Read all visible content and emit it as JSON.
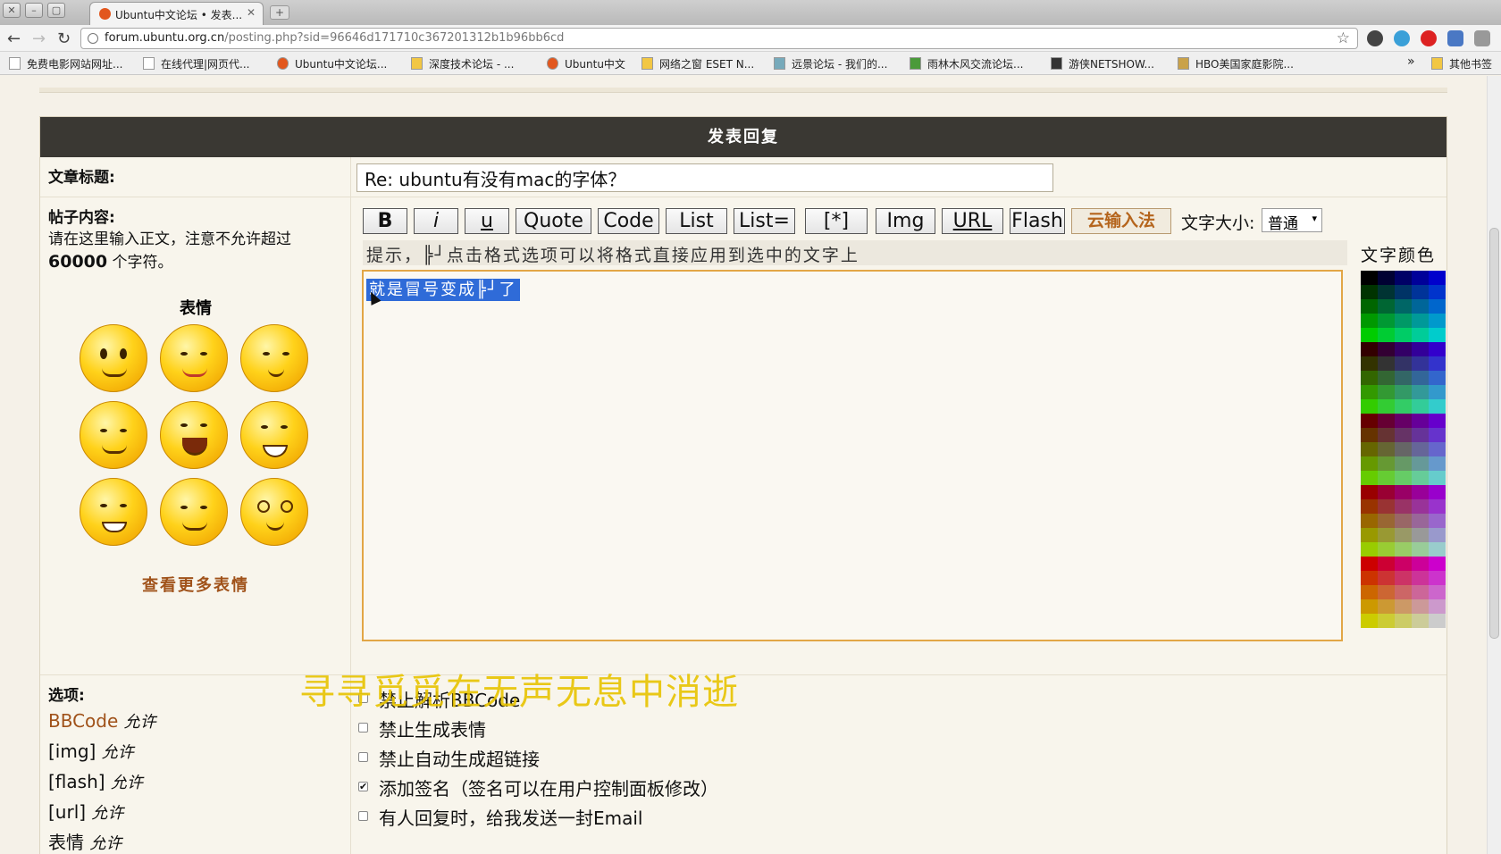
{
  "browser": {
    "tab_title": "Ubuntu中文论坛 • 发表...",
    "url_host": "forum.ubuntu.org.cn",
    "url_path": "/posting.php?sid=96646d171710c367201312b1b96bb6cd",
    "bookmarks": [
      "免费电影网站网址...",
      "在线代理|网页代...",
      "Ubuntu中文论坛...",
      "深度技术论坛 - ...",
      "Ubuntu中文",
      "网络之窗 ESET N...",
      "远景论坛 - 我们的...",
      "雨林木风交流论坛...",
      "游侠NETSHOW...",
      "HBO美国家庭影院..."
    ],
    "other_bookmarks": "其他书签",
    "more_bookmarks": "»"
  },
  "panel": {
    "title": "发表回复"
  },
  "subject": {
    "label": "文章标题:",
    "value": "Re: ubuntu有没有mac的字体？"
  },
  "content": {
    "label": "帖子内容:",
    "hint": "请在这里输入正文，注意不允许超过",
    "limit": "60000",
    "limit_suffix": "个字符。",
    "emote_title": "表情",
    "more_emotes": "查看更多表情",
    "buttons": [
      "B",
      "i",
      "u",
      "Quote",
      "Code",
      "List",
      "List=",
      "[*]",
      "Img",
      "URL",
      "Flash"
    ],
    "cloud_ime": "云输入法",
    "font_size_label": "文字大小:",
    "font_size_value": "普通",
    "tip": "提示，╠┘点击格式选项可以将格式直接应用到选中的文字上",
    "body_text": "就是冒号变成╠┘了",
    "color_label": "文字颜色"
  },
  "options": {
    "label": "选项:",
    "bbcode": "BBCode",
    "allowed": "允许",
    "img": "[img]",
    "flash": "[flash]",
    "url": "[url]",
    "smilies": "表情",
    "checkboxes": [
      {
        "label": "禁止解析BBCode",
        "checked": false
      },
      {
        "label": "禁止生成表情",
        "checked": false
      },
      {
        "label": "禁止自动生成超链接",
        "checked": false
      },
      {
        "label": "添加签名（签名可以在用户控制面板修改）",
        "checked": true
      },
      {
        "label": "有人回复时，给我发送一封Email",
        "checked": false
      }
    ]
  },
  "overlay": "寻寻觅觅在无声无息中消逝"
}
